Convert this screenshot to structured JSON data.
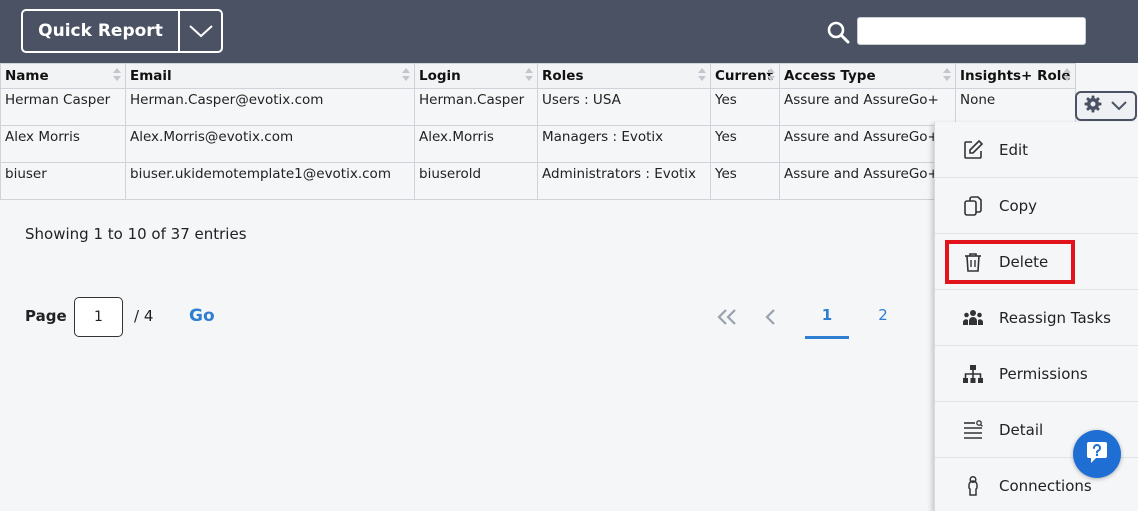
{
  "header": {
    "quick_report_label": "Quick Report",
    "search_placeholder": ""
  },
  "table": {
    "columns": [
      "Name",
      "Email",
      "Login",
      "Roles",
      "Current",
      "Access Type",
      "Insights+ Role"
    ],
    "rows": [
      {
        "name": "Herman Casper",
        "email": "Herman.Casper@evotix.com",
        "login": "Herman.Casper",
        "roles": "Users : USA",
        "current": "Yes",
        "access_type": "Assure and AssureGo+",
        "insights_role": "None"
      },
      {
        "name": "Alex Morris",
        "email": "Alex.Morris@evotix.com",
        "login": "Alex.Morris",
        "roles": "Managers : Evotix",
        "current": "Yes",
        "access_type": "Assure and AssureGo+",
        "insights_role": ""
      },
      {
        "name": "biuser",
        "email": "biuser.ukidemotemplate1@evotix.com",
        "login": "biuserold",
        "roles": "Administrators : Evotix",
        "current": "Yes",
        "access_type": "Assure and AssureGo+",
        "insights_role": ""
      }
    ]
  },
  "footer": {
    "showing_text": "Showing 1 to 10 of 37 entries",
    "page_label": "Page",
    "page_value": "1",
    "page_total": "/ 4",
    "go_label": "Go",
    "pages": [
      "1",
      "2"
    ]
  },
  "menu": {
    "items": [
      {
        "label": "Edit",
        "icon": "edit-icon"
      },
      {
        "label": "Copy",
        "icon": "copy-icon"
      },
      {
        "label": "Delete",
        "icon": "trash-icon"
      },
      {
        "label": "Reassign Tasks",
        "icon": "users-icon"
      },
      {
        "label": "Permissions",
        "icon": "hierarchy-icon"
      },
      {
        "label": "Detail",
        "icon": "list-detail-icon"
      },
      {
        "label": "Connections",
        "icon": "person-icon"
      }
    ]
  },
  "colors": {
    "header_bg": "#4a5263",
    "accent": "#2f7fd1",
    "highlight": "#e1131b",
    "help_button": "#1f6ed4"
  }
}
